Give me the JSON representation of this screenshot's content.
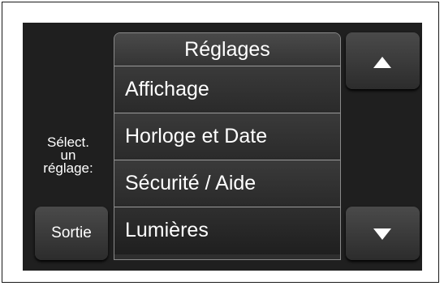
{
  "menu": {
    "title": "Réglages",
    "items": [
      "Affichage",
      "Horloge et Date",
      "Sécurité / Aide",
      "Lumières"
    ]
  },
  "prompt": {
    "line1": "Sélect.",
    "line2": "un",
    "line3": "réglage:"
  },
  "buttons": {
    "exit_label": "Sortie",
    "up_icon": "arrow-up-icon",
    "down_icon": "arrow-down-icon"
  },
  "colors": {
    "screen_bg": "#1f1f1f",
    "text": "#ffffff"
  }
}
